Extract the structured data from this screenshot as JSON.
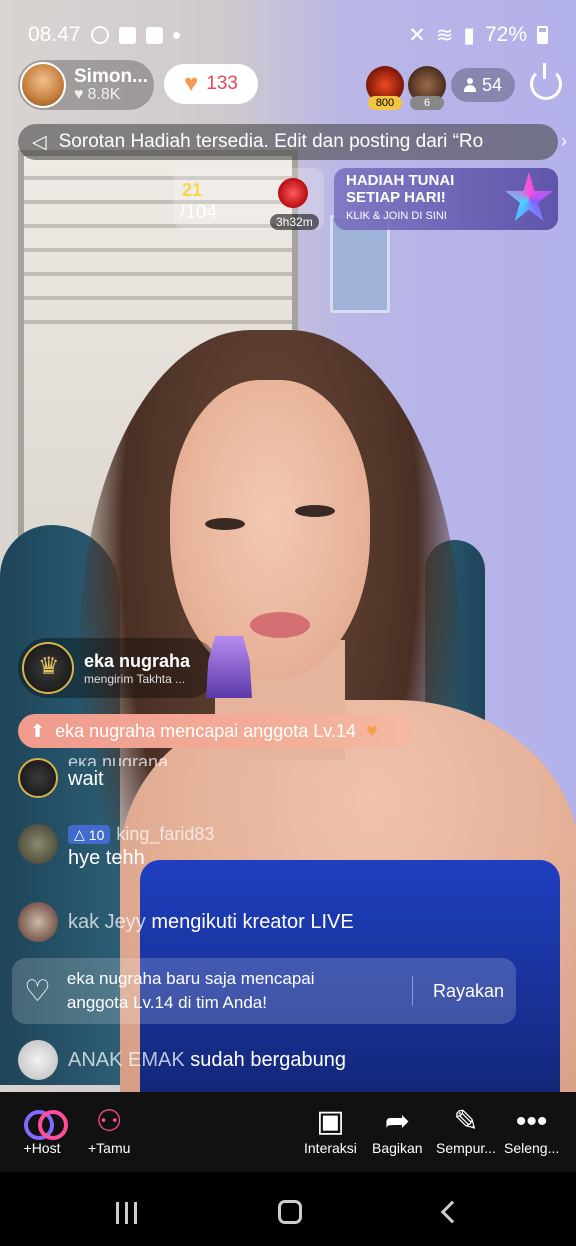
{
  "status_bar": {
    "time": "08.47",
    "battery": "72%"
  },
  "host": {
    "name": "Simon...",
    "likes": "8.8K"
  },
  "like_pill": {
    "count": "133"
  },
  "viewers": {
    "badge_1": "800",
    "badge_2": "6",
    "count": "54"
  },
  "announcement": {
    "text": "Sorotan Hadiah tersedia. Edit dan posting dari “Ro"
  },
  "rank_widget": {
    "current": "21",
    "total": "/104",
    "timer": "3h32m"
  },
  "promo": {
    "title_1": "HADIAH TUNAI",
    "title_2": "SETIAP HARI!",
    "subtitle": "KLIK & JOIN DI SINI"
  },
  "gift": {
    "user": "eka nugraha",
    "action": "mengirim Takhta ..."
  },
  "level_up": {
    "text": "eka nugraha mencapai anggota Lv.14"
  },
  "chat": [
    {
      "user": "eka nugraha",
      "message": "wait"
    },
    {
      "user": "king_farid83",
      "level": "10",
      "message": "hye tehh"
    }
  ],
  "follow_event": {
    "user": "kak Jeyy",
    "action": "mengikuti kreator LIVE"
  },
  "notification": {
    "text_1": "eka nugraha baru saja mencapai",
    "text_2": "anggota Lv.14 di tim Anda!",
    "button": "Rayakan"
  },
  "joined_event": {
    "user": "ANAK EMAK",
    "action": "sudah bergabung"
  },
  "toolbar": {
    "host": "+Host",
    "guest": "+Tamu",
    "interact": "Interaksi",
    "share": "Bagikan",
    "enhance": "Sempur...",
    "more": "Seleng..."
  }
}
